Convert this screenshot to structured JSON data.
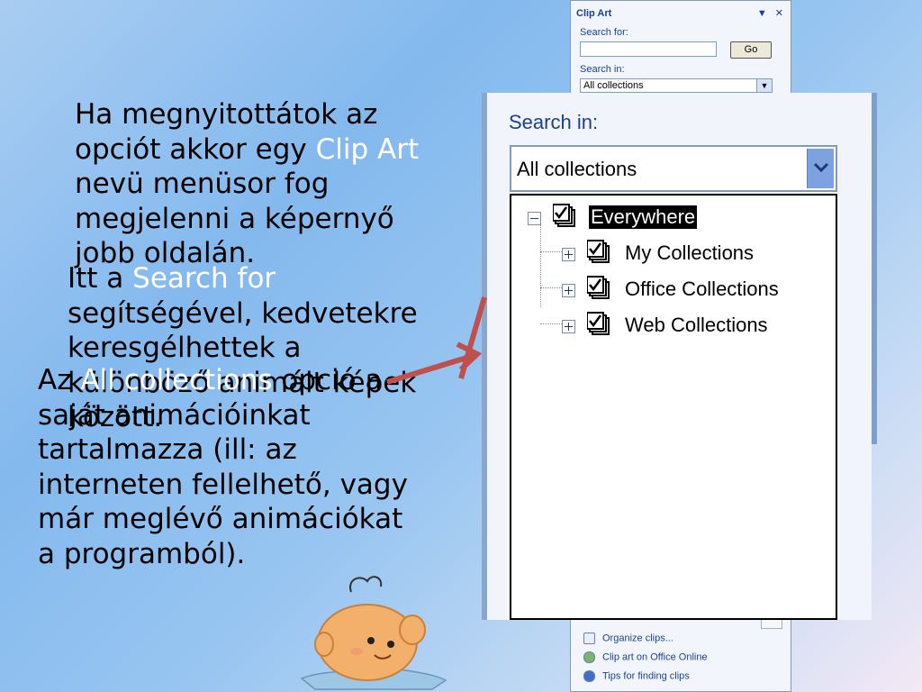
{
  "slide": {
    "para1": {
      "pre": "Ha megnyitottátok az opciót akkor egy ",
      "highlight": "Clip Art",
      "post": " nevü menüsor fog megjelenni a képernyő jobb oldalán."
    },
    "para2": {
      "pre": "Itt a ",
      "highlight": "Search for",
      "post": " segítségével, kedvetekre keresgélhettek a különböző animált képek között."
    },
    "para3": {
      "pre": "Az ",
      "highlight": "All collections",
      "post": " opció a saját animációinkat tartalmazza (ill: az interneten fellelhető, vagy már meglévő animációkat a programból)."
    }
  },
  "clip_art_pane": {
    "title": "Clip Art",
    "menu_glyph": "▼",
    "close_glyph": "✕",
    "search_for_label": "Search for:",
    "search_value": "",
    "go_label": "Go",
    "search_in_label": "Search in:",
    "search_in_value": "All collections",
    "links": [
      {
        "label": "Organize clips...",
        "icon": "organize-icon"
      },
      {
        "label": "Clip art on Office Online",
        "icon": "globe-icon"
      },
      {
        "label": "Tips for finding clips",
        "icon": "help-icon"
      }
    ]
  },
  "zoomed_dropdown": {
    "label": "Search in:",
    "value": "All collections",
    "tree": [
      {
        "label": "Everywhere",
        "expanded": true,
        "checked": true,
        "selected": true
      },
      {
        "label": "My Collections",
        "expanded": false,
        "checked": true,
        "selected": false
      },
      {
        "label": "Office Collections",
        "expanded": false,
        "checked": true,
        "selected": false
      },
      {
        "label": "Web Collections",
        "expanded": false,
        "checked": true,
        "selected": false
      }
    ]
  },
  "colors": {
    "highlight_text": "#ffffff",
    "arrow": "#c0504d",
    "pane_text": "#1c3f94"
  }
}
